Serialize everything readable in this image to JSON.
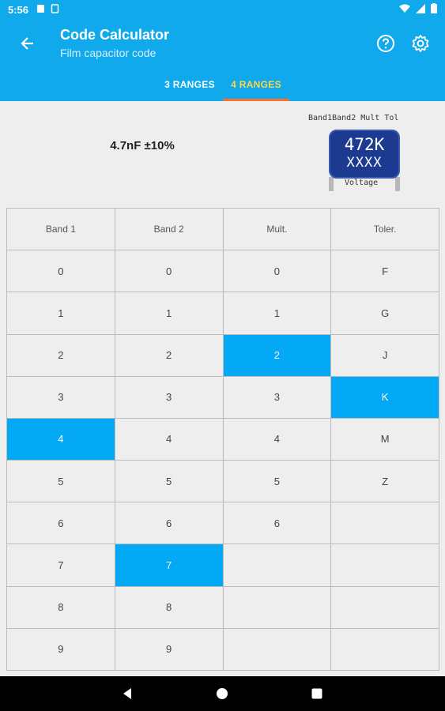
{
  "status_bar": {
    "time": "5:56"
  },
  "app_bar": {
    "title": "Code Calculator",
    "subtitle": "Film capacitor code"
  },
  "tabs": [
    {
      "label": "3 RANGES",
      "active": false
    },
    {
      "label": "4 RANGES",
      "active": true
    }
  ],
  "result": {
    "value": "4.7nF ±10%"
  },
  "capacitor": {
    "labels": [
      "Band1",
      "Band2",
      "Mult",
      "Tol"
    ],
    "code": "472K",
    "line2": "XXXX",
    "voltage": "Voltage"
  },
  "table": {
    "headers": [
      "Band 1",
      "Band 2",
      "Mult.",
      "Toler."
    ],
    "columns": [
      {
        "name": "band1",
        "values": [
          "0",
          "1",
          "2",
          "3",
          "4",
          "5",
          "6",
          "7",
          "8",
          "9"
        ],
        "selected": "4"
      },
      {
        "name": "band2",
        "values": [
          "0",
          "1",
          "2",
          "3",
          "4",
          "5",
          "6",
          "7",
          "8",
          "9"
        ],
        "selected": "7"
      },
      {
        "name": "mult",
        "values": [
          "0",
          "1",
          "2",
          "3",
          "4",
          "5",
          "6",
          "",
          "",
          ""
        ],
        "selected": "2"
      },
      {
        "name": "toler",
        "values": [
          "F",
          "G",
          "J",
          "K",
          "M",
          "Z",
          "",
          "",
          "",
          ""
        ],
        "selected": "K"
      }
    ]
  },
  "colors": {
    "primary": "#0fa9ec",
    "selected": "#03a9f4",
    "active_tab": "#ffd64a",
    "indicator": "#ff6f2c",
    "capacitor": "#1c3b90"
  },
  "icons": [
    "back-arrow-icon",
    "help-icon",
    "settings-gear-icon",
    "nav-back-icon",
    "nav-home-icon",
    "nav-recents-icon"
  ]
}
